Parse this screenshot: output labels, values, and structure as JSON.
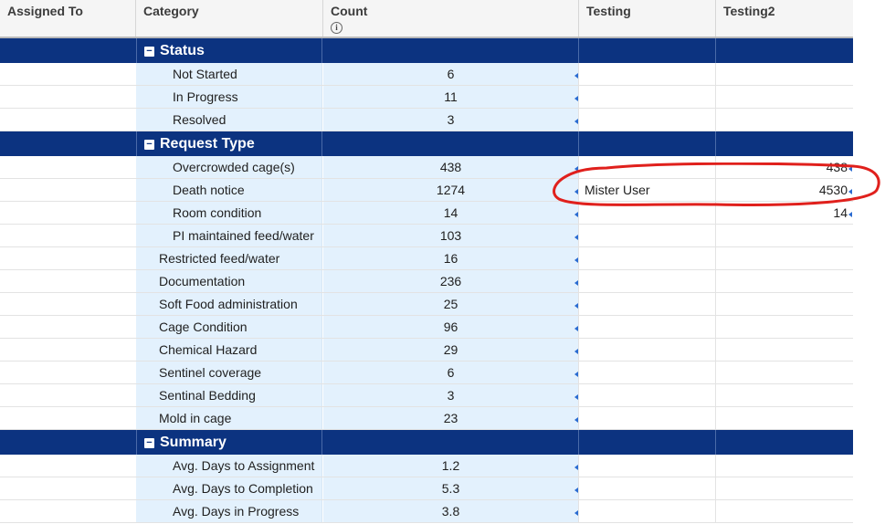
{
  "columns": {
    "assigned_to": "Assigned To",
    "category": "Category",
    "count": "Count",
    "testing": "Testing",
    "testing2": "Testing2"
  },
  "groups": [
    {
      "title": "Status",
      "rows": [
        {
          "category": "Not Started",
          "count": "6",
          "indent": "sub"
        },
        {
          "category": "In Progress",
          "count": "11",
          "indent": "sub"
        },
        {
          "category": "Resolved",
          "count": "3",
          "indent": "sub"
        }
      ]
    },
    {
      "title": "Request Type",
      "rows": [
        {
          "category": "Overcrowded cage(s)",
          "count": "438",
          "indent": "sub",
          "testing2": "438"
        },
        {
          "category": "Death notice",
          "count": "1274",
          "indent": "sub",
          "testing": "Mister User",
          "testing2": "4530"
        },
        {
          "category": "Room condition",
          "count": "14",
          "indent": "sub",
          "testing2": "14"
        },
        {
          "category": "PI maintained feed/water",
          "count": "103",
          "indent": "sub"
        },
        {
          "category": "Restricted feed/water",
          "count": "16",
          "indent": "top"
        },
        {
          "category": "Documentation",
          "count": "236",
          "indent": "top"
        },
        {
          "category": "Soft Food administration",
          "count": "25",
          "indent": "top"
        },
        {
          "category": "Cage Condition",
          "count": "96",
          "indent": "top"
        },
        {
          "category": "Chemical Hazard",
          "count": "29",
          "indent": "top"
        },
        {
          "category": "Sentinel coverage",
          "count": "6",
          "indent": "top"
        },
        {
          "category": "Sentinal Bedding",
          "count": "3",
          "indent": "top"
        },
        {
          "category": "Mold in cage",
          "count": "23",
          "indent": "top"
        }
      ]
    },
    {
      "title": "Summary",
      "rows": [
        {
          "category": "Avg. Days to Assignment",
          "count": "1.2",
          "indent": "sub"
        },
        {
          "category": "Avg. Days to Completion",
          "count": "5.3",
          "indent": "sub"
        },
        {
          "category": "Avg. Days in Progress",
          "count": "3.8",
          "indent": "sub"
        }
      ]
    }
  ],
  "icons": {
    "count_info": "info-icon",
    "group_toggle": "collapse-icon",
    "cell_marker": "triangle-marker-icon"
  },
  "colors": {
    "group_header_bg": "#0c3380",
    "category_bg": "#e3f1fd",
    "annotation": "#e0201c",
    "marker": "#2a6bd1"
  }
}
